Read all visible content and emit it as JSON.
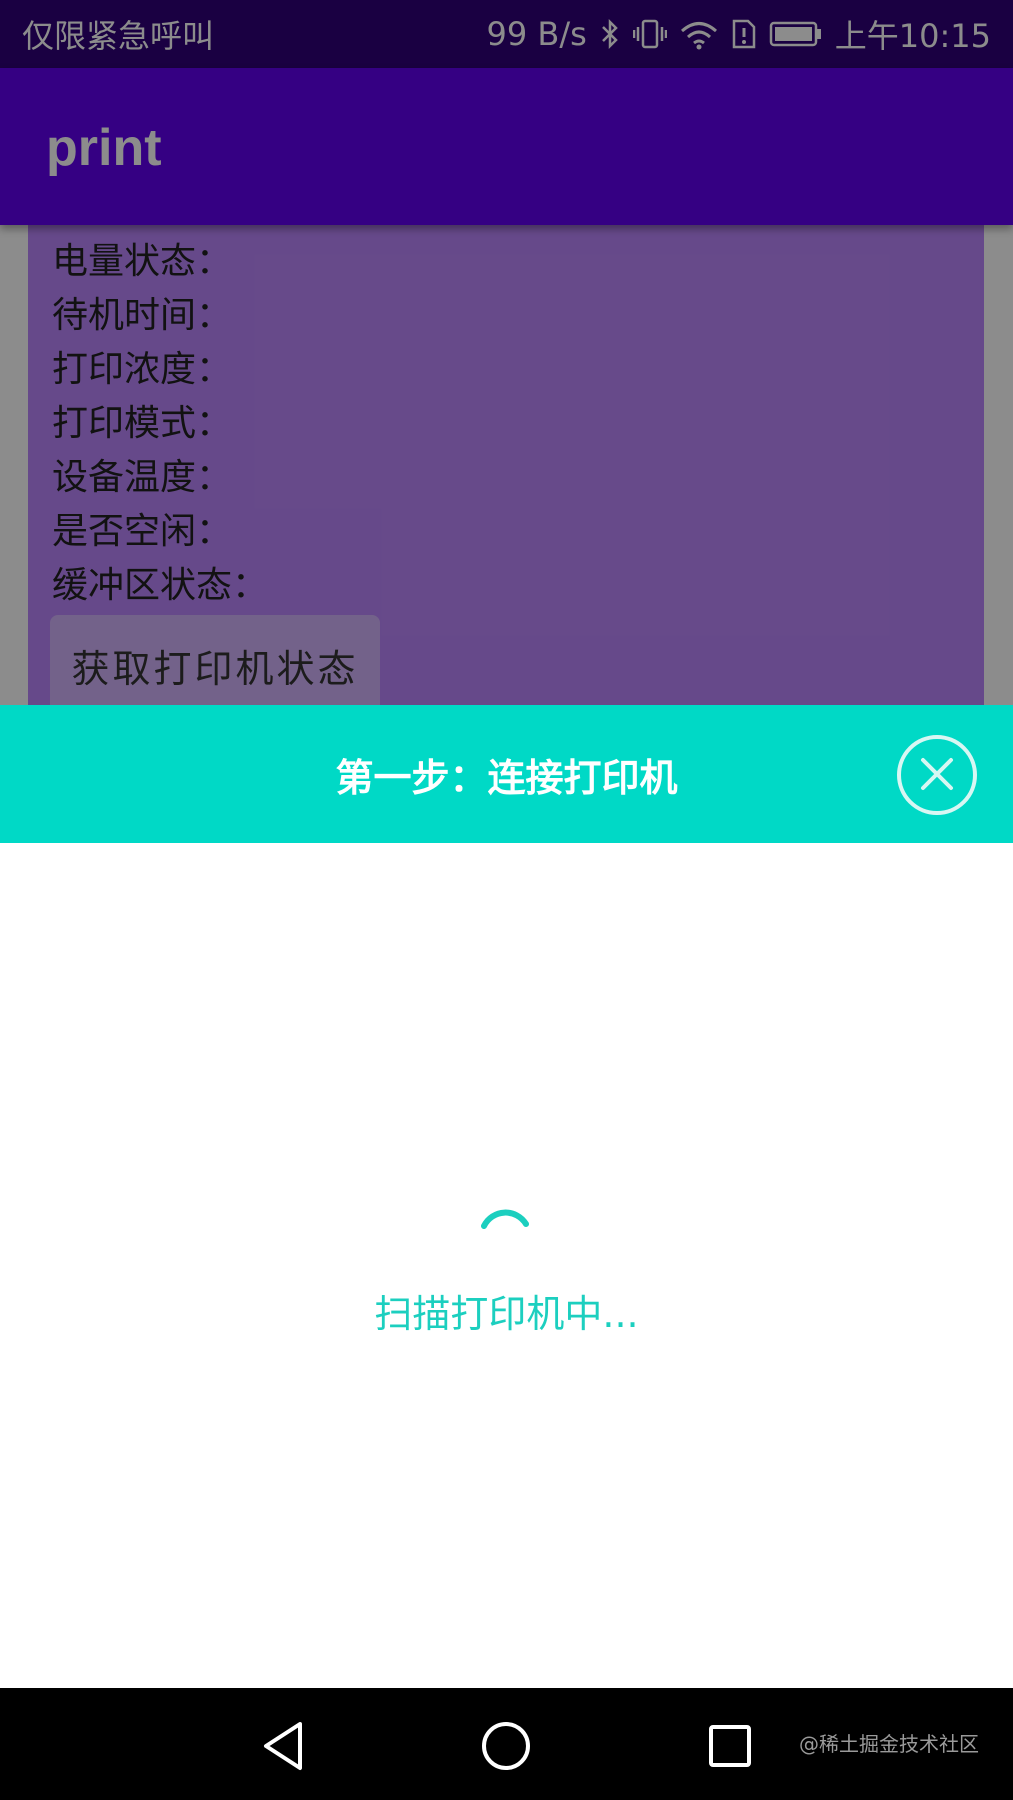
{
  "status_bar": {
    "left_text": "仅限紧急呼叫",
    "net_speed": "99 B/s",
    "time": "上午10:15",
    "icons": [
      "bluetooth-icon",
      "vibrate-icon",
      "wifi-icon",
      "sim-alert-icon",
      "battery-icon"
    ]
  },
  "app_bar": {
    "title": "print"
  },
  "status_card": {
    "rows": [
      "电量状态：",
      "待机时间：",
      "打印浓度：",
      "打印模式：",
      "设备温度：",
      "是否空闲：",
      "缓冲区状态："
    ],
    "button_label": "获取打印机状态"
  },
  "sheet": {
    "title": "第一步：连接打印机",
    "close_icon": "close-circle-icon",
    "scan_text": "扫描打印机中..."
  },
  "nav_bar": {
    "icons": [
      "back-icon",
      "home-icon",
      "recents-icon"
    ],
    "watermark": "@稀土掘金技术社区"
  },
  "colors": {
    "status_bar_bg": "#300078",
    "app_bar_bg": "#6200ee",
    "card_bg": "#bb86fc",
    "accent_teal": "#00d9c6",
    "scan_text": "#1ccfbf"
  }
}
